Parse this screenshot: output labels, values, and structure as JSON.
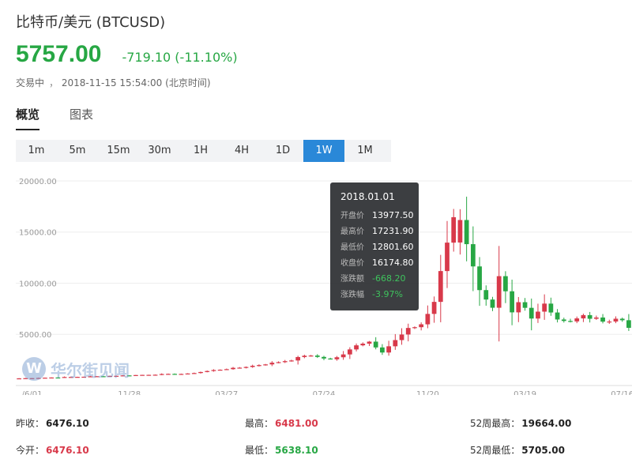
{
  "header": {
    "title": "比特币/美元 (BTCUSD)",
    "price": "5757.00",
    "change": "-719.10 (-11.10%)",
    "status_label": "交易中",
    "timestamp": "2018-11-15 15:54:00",
    "timezone": "(北京时间)"
  },
  "tabs": [
    {
      "label": "概览",
      "active": true
    },
    {
      "label": "图表",
      "active": false
    }
  ],
  "periods": [
    {
      "label": "1m"
    },
    {
      "label": "5m"
    },
    {
      "label": "15m"
    },
    {
      "label": "30m"
    },
    {
      "label": "1H"
    },
    {
      "label": "4H"
    },
    {
      "label": "1D"
    },
    {
      "label": "1W",
      "active": true
    },
    {
      "label": "1M"
    }
  ],
  "watermark": "华尔街见闻",
  "colors": {
    "up": "#d8394a",
    "down": "#27a744",
    "accent": "#2a88d8"
  },
  "chart_data": {
    "type": "candlestick",
    "ylim": [
      0,
      21000
    ],
    "y_ticks": [
      "20000.00",
      "15000.00",
      "10000.00",
      "5000.00"
    ],
    "y_tick_values": [
      20000,
      15000,
      10000,
      5000
    ],
    "x_ticks": [
      "/6/01",
      "11/28",
      "03/27",
      "07/24",
      "11/20",
      "03/19",
      "07/16"
    ],
    "anchors": [
      [
        0,
        700
      ],
      [
        12,
        900
      ],
      [
        22,
        1100
      ],
      [
        26,
        1150
      ],
      [
        30,
        1500
      ],
      [
        34,
        1750
      ],
      [
        38,
        2100
      ],
      [
        42,
        2500
      ],
      [
        44,
        2950
      ],
      [
        46,
        2800
      ],
      [
        48,
        2550
      ],
      [
        50,
        3000
      ],
      [
        52,
        4000
      ],
      [
        54,
        4300
      ],
      [
        56,
        3300
      ],
      [
        58,
        4400
      ],
      [
        60,
        5500
      ],
      [
        62,
        6000
      ],
      [
        63,
        7000
      ],
      [
        64,
        8200
      ],
      [
        65,
        11000
      ],
      [
        66,
        14000
      ],
      [
        67,
        16500
      ],
      [
        68,
        16174
      ],
      [
        69,
        14000
      ],
      [
        70,
        11500
      ],
      [
        71,
        9500
      ],
      [
        72,
        8500
      ],
      [
        73,
        7500
      ],
      [
        74,
        10500
      ],
      [
        75,
        9000
      ],
      [
        76,
        7000
      ],
      [
        77,
        8000
      ],
      [
        78,
        7500
      ],
      [
        79,
        6500
      ],
      [
        80,
        7200
      ],
      [
        81,
        8200
      ],
      [
        82,
        7200
      ],
      [
        83,
        6500
      ],
      [
        84,
        6400
      ],
      [
        85,
        6300
      ],
      [
        86,
        6500
      ],
      [
        87,
        6800
      ],
      [
        88,
        6600
      ],
      [
        89,
        6500
      ],
      [
        90,
        6400
      ],
      [
        91,
        6300
      ],
      [
        92,
        6500
      ],
      [
        93,
        6400
      ],
      [
        94,
        5757
      ]
    ],
    "tooltip": {
      "date": "2018.01.01",
      "rows": [
        {
          "label": "开盘价",
          "value": "13977.50"
        },
        {
          "label": "最高价",
          "value": "17231.90"
        },
        {
          "label": "最低价",
          "value": "12801.60"
        },
        {
          "label": "收盘价",
          "value": "16174.80"
        },
        {
          "label": "涨跌额",
          "value": "-668.20"
        },
        {
          "label": "涨跌幅",
          "value": "-3.97%"
        }
      ]
    }
  },
  "stats": {
    "prev_close_label": "昨收：",
    "prev_close": "6476.10",
    "high_label": "最高：",
    "high": "6481.00",
    "high52_label": "52周最高：",
    "high52": "19664.00",
    "open_label": "今开：",
    "open": "6476.10",
    "low_label": "最低：",
    "low": "5638.10",
    "low52_label": "52周最低：",
    "low52": "5705.00"
  }
}
